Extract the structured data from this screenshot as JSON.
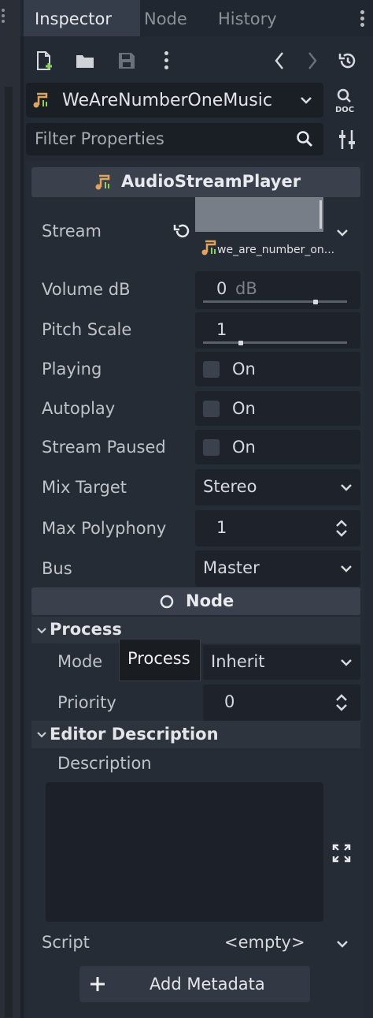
{
  "tabs": [
    "Inspector",
    "Node",
    "History"
  ],
  "object_selector": {
    "name": "WeAreNumberOneMusic"
  },
  "filter": {
    "placeholder": "Filter Properties"
  },
  "class_header": "AudioStreamPlayer",
  "stream": {
    "label": "Stream",
    "resource_name": "we_are_number_on..."
  },
  "properties": {
    "volume": {
      "label": "Volume dB",
      "value": "0",
      "unit": "dB",
      "slider_fraction": 0.78
    },
    "pitch": {
      "label": "Pitch Scale",
      "value": "1",
      "slider_fraction": 0.26
    },
    "playing": {
      "label": "Playing",
      "toggle": "On",
      "checked": false
    },
    "autoplay": {
      "label": "Autoplay",
      "toggle": "On",
      "checked": false
    },
    "paused": {
      "label": "Stream Paused",
      "toggle": "On",
      "checked": false
    },
    "mix_target": {
      "label": "Mix Target",
      "value": "Stereo"
    },
    "max_polyphony": {
      "label": "Max Polyphony",
      "value": "1"
    },
    "bus": {
      "label": "Bus",
      "value": "Master"
    }
  },
  "node_header": "Node",
  "process_section": {
    "title": "Process",
    "mode_label": "Mode",
    "mode_value": "Inherit",
    "tooltip": "Process",
    "priority_label": "Priority",
    "priority_value": "0"
  },
  "editor_description": {
    "title": "Editor Description",
    "description_label": "Description",
    "description_value": ""
  },
  "script": {
    "label": "Script",
    "value": "<empty>"
  },
  "add_metadata_label": "Add Metadata",
  "colors": {
    "accent_orange": "#e0a35c",
    "accent_green": "#8ed061",
    "panel_bg": "#242a33",
    "active_tab": "#363d4a"
  }
}
